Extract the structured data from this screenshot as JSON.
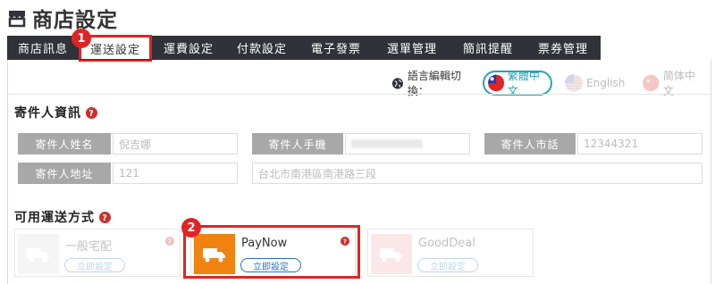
{
  "header": {
    "title": "商店設定"
  },
  "tabs": [
    {
      "label": "商店訊息"
    },
    {
      "label": "運送設定"
    },
    {
      "label": "運費設定"
    },
    {
      "label": "付款設定"
    },
    {
      "label": "電子發票"
    },
    {
      "label": "選單管理"
    },
    {
      "label": "簡訊提醒"
    },
    {
      "label": "票券管理"
    }
  ],
  "language": {
    "label": "語言編輯切換：",
    "options": [
      {
        "label": "繁體中文",
        "active": true
      },
      {
        "label": "English",
        "active": false
      },
      {
        "label": "简体中文",
        "active": false
      }
    ]
  },
  "sender": {
    "title": "寄件人資訊",
    "name_label": "寄件人姓名",
    "name_value": "倪吉娜",
    "mobile_label": "寄件人手機",
    "phone_label": "寄件人市話",
    "phone_value": "12344321",
    "address_label": "寄件人地址",
    "zip_value": "121",
    "address_value": "台北市南港區南港路三段"
  },
  "shipping": {
    "title": "可用運送方式",
    "methods": [
      {
        "name": "一般宅配",
        "button": "立即設定",
        "color": "#e0e0e0"
      },
      {
        "name": "PayNow",
        "button": "立即設定",
        "color": "#f0820f"
      },
      {
        "name": "GoodDeal",
        "button": "立即設定",
        "color": "#f2b3b3"
      }
    ]
  },
  "annotations": {
    "step1": "1",
    "step2": "2"
  },
  "colors": {
    "accent": "#e02424",
    "tab_bg": "#2f3238",
    "link": "#2a6fc9",
    "lang_active": "#26a3b3"
  }
}
